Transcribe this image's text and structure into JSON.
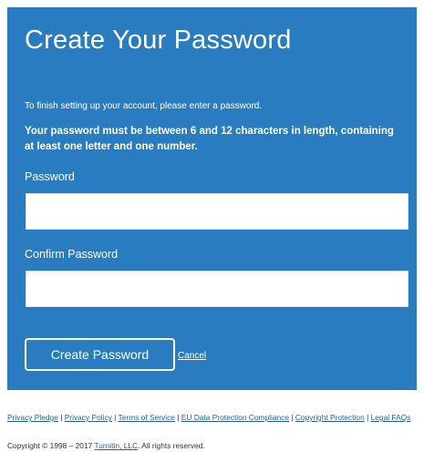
{
  "form": {
    "title": "Create Your Password",
    "intro": "To finish setting up your account, please enter a password.",
    "rule": "Your password must be between 6 and 12 characters in length, containing at least one letter and one number.",
    "password_label": "Password",
    "password_value": "",
    "confirm_label": "Confirm Password",
    "confirm_value": "",
    "submit_label": "Create Password",
    "cancel_label": "Cancel"
  },
  "footer": {
    "links": [
      "Privacy Pledge",
      "Privacy Policy",
      "Terms of Service",
      "EU Data Protection Compliance",
      "Copyright Protection",
      "Legal FAQs"
    ],
    "separator": "|",
    "copyright_prefix": "Copyright © 1998 – 2017",
    "company_link": "Turnitin, LLC",
    "copyright_suffix": ". All rights reserved."
  },
  "colors": {
    "panel_background": "#2a7cc0",
    "panel_text": "#ffffff",
    "link": "#1f5fa8"
  }
}
